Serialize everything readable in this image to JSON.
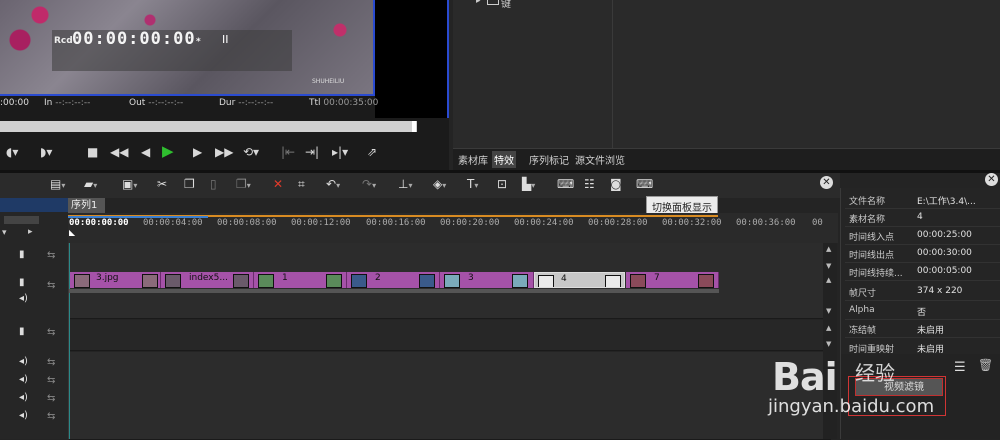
{
  "preview": {
    "rcd_label": "Rcd",
    "timecode": "00:00:00:00",
    "timecode_suffix": "*",
    "pause_symbol": "II",
    "time_rows": {
      "in_start": ":00:00",
      "in_label": "In",
      "in_value": "--:--:--:--",
      "out_label": "Out",
      "out_value": "--:--:--:--",
      "dur_label": "Dur",
      "dur_value": "--:--:--:--",
      "ttl_label": "Ttl",
      "ttl_value": "00:00:35:00"
    },
    "watermark_text": "SHUHEILIU"
  },
  "library": {
    "tree_label": "键",
    "tabs": [
      "素材库",
      "特效",
      "序列标记",
      "源文件浏览"
    ],
    "active_tab": "特效"
  },
  "toolbar": {
    "tooltip": "切换面板显示"
  },
  "timeline": {
    "sequence_tab": "序列1",
    "ruler_ticks": [
      "00:00:00:00",
      "00:00:04:00",
      "00:00:08:00",
      "00:00:12:00",
      "00:00:16:00",
      "00:00:20:00",
      "00:00:24:00",
      "00:00:28:00",
      "00:00:32:00",
      "00:00:36:00",
      "00"
    ],
    "clips": [
      {
        "label": "3.jpg",
        "selected": false
      },
      {
        "label": "index5...",
        "selected": false
      },
      {
        "label": "1",
        "selected": false
      },
      {
        "label": "2",
        "selected": false
      },
      {
        "label": "3",
        "selected": false
      },
      {
        "label": "4",
        "selected": true
      },
      {
        "label": "7",
        "selected": false
      }
    ]
  },
  "properties": {
    "rows": [
      {
        "key": "文件名称",
        "value": "E:\\工作\\3.4\\..."
      },
      {
        "key": "素材名称",
        "value": "4"
      },
      {
        "key": "时间线入点",
        "value": "00:00:25:00"
      },
      {
        "key": "时间线出点",
        "value": "00:00:30:00"
      },
      {
        "key": "时间线持续...",
        "value": "00:00:05:00"
      },
      {
        "key": "帧尺寸",
        "value": "374 x 220"
      },
      {
        "key": "Alpha",
        "value": "否"
      },
      {
        "key": "冻结帧",
        "value": "未启用"
      },
      {
        "key": "时间重映射",
        "value": "未启用"
      }
    ],
    "effect_item": "视频滤镜"
  },
  "watermark": {
    "logo": "Bai",
    "logo_suffix": "经验",
    "url": "jingyan.baidu.com"
  }
}
